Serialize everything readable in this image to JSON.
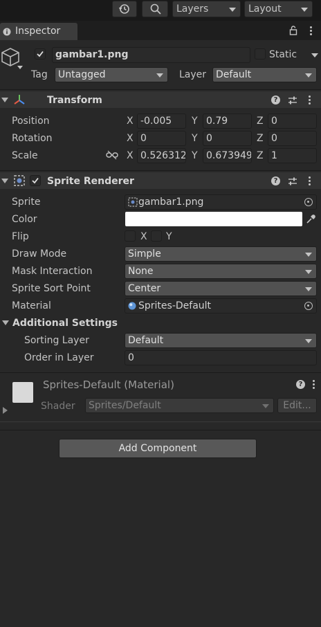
{
  "toolbar": {
    "history_icon": "history-icon",
    "search_icon": "search-icon",
    "layers_label": "Layers",
    "layout_label": "Layout"
  },
  "tab": {
    "icon": "info-icon",
    "label": "Inspector",
    "lock_icon": "lock-icon",
    "menu_icon": "kebab-menu-icon"
  },
  "gameobject": {
    "icon": "cube-icon",
    "active": true,
    "name": "gambar1.png",
    "static_label": "Static",
    "static_checked": false,
    "tag_label": "Tag",
    "tag_value": "Untagged",
    "layer_label": "Layer",
    "layer_value": "Default"
  },
  "transform": {
    "icon": "transform-axes-icon",
    "title": "Transform",
    "position_label": "Position",
    "rotation_label": "Rotation",
    "scale_label": "Scale",
    "axis_x": "X",
    "axis_y": "Y",
    "axis_z": "Z",
    "position": {
      "x": "-0.005",
      "y": "0.79",
      "z": "0"
    },
    "rotation": {
      "x": "0",
      "y": "0",
      "z": "0"
    },
    "scale": {
      "x": "0.526312",
      "y": "0.673949",
      "z": "1"
    },
    "scale_link_icon": "unlinked-chain-icon"
  },
  "sprite_renderer": {
    "icon": "sprite-renderer-icon",
    "enabled": true,
    "title": "Sprite Renderer",
    "sprite_label": "Sprite",
    "sprite_value": "gambar1.png",
    "sprite_icon": "sprite-asset-icon",
    "color_label": "Color",
    "color_value": "#ffffff",
    "eyedropper_icon": "eyedropper-icon",
    "flip_label": "Flip",
    "flip_x": "X",
    "flip_y": "Y",
    "draw_mode_label": "Draw Mode",
    "draw_mode_value": "Simple",
    "mask_label": "Mask Interaction",
    "mask_value": "None",
    "sort_point_label": "Sprite Sort Point",
    "sort_point_value": "Center",
    "material_label": "Material",
    "material_value": "Sprites-Default",
    "material_icon": "material-sphere-icon",
    "additional_label": "Additional Settings",
    "sorting_layer_label": "Sorting Layer",
    "sorting_layer_value": "Default",
    "order_label": "Order in Layer",
    "order_value": "0"
  },
  "material": {
    "title": "Sprites-Default (Material)",
    "shader_label": "Shader",
    "shader_value": "Sprites/Default",
    "edit_label": "Edit...",
    "preview_color": "#d9d9d9"
  },
  "add_component_label": "Add Component",
  "icons": {
    "help": "help-icon",
    "presets": "presets-sliders-icon",
    "menu": "kebab-menu-icon",
    "object_picker": "object-picker-icon"
  },
  "colors": {
    "background": "#282828",
    "toolbar": "#191919",
    "field": "#2a2a2a",
    "dropdown": "#515151",
    "text": "#c4c4c4"
  }
}
